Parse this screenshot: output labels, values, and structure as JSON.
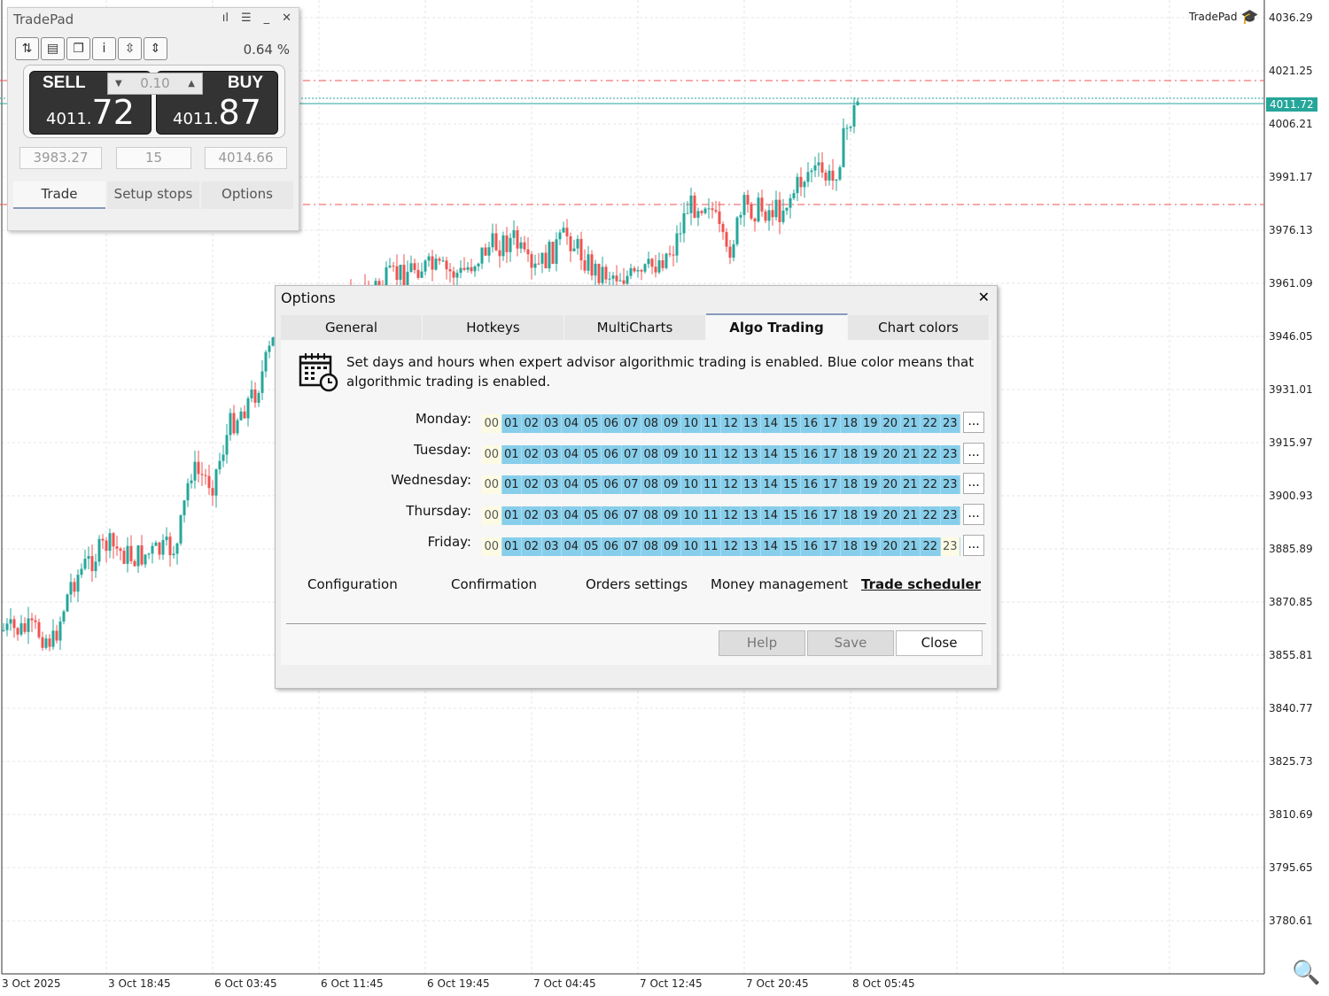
{
  "chart": {
    "price_axis": [
      "4036.29",
      "4021.25",
      "4006.21",
      "3991.17",
      "3976.13",
      "3961.09",
      "3946.05",
      "3931.01",
      "3915.97",
      "3900.93",
      "3885.89",
      "3870.85",
      "3855.81",
      "3840.77",
      "3825.73",
      "3810.69",
      "3795.65",
      "3780.61"
    ],
    "time_axis": [
      "3 Oct 2025",
      "3 Oct 18:45",
      "6 Oct 03:45",
      "6 Oct 11:45",
      "6 Oct 19:45",
      "7 Oct 04:45",
      "7 Oct 12:45",
      "7 Oct 20:45",
      "8 Oct 05:45"
    ],
    "current_price": "4011.72",
    "brand_label": "TradePad",
    "colors": {
      "bull": "#26a69a",
      "bear": "#ef5350",
      "grid": "#e6e6e6"
    }
  },
  "tradepad": {
    "title": "TradePad",
    "percent": "0.64 %",
    "sell_label": "SELL",
    "buy_label": "BUY",
    "lot": "0.10",
    "sell_price_main": "4011.",
    "sell_price_big": "72",
    "buy_price_main": "4011.",
    "buy_price_big": "87",
    "sl": "3983.27",
    "spread": "15",
    "tp": "4014.66",
    "tabs": [
      "Trade",
      "Setup stops",
      "Options"
    ]
  },
  "dialog": {
    "title": "Options",
    "tabs": [
      "General",
      "Hotkeys",
      "MultiCharts",
      "Algo Trading",
      "Chart colors"
    ],
    "description": "Set days and hours when expert advisor algorithmic trading is enabled. Blue color means that algorithmic trading is enabled.",
    "hours": [
      "00",
      "01",
      "02",
      "03",
      "04",
      "05",
      "06",
      "07",
      "08",
      "09",
      "10",
      "11",
      "12",
      "13",
      "14",
      "15",
      "16",
      "17",
      "18",
      "19",
      "20",
      "21",
      "22",
      "23"
    ],
    "days": [
      {
        "name": "Monday:",
        "disabled_hours": [
          "00"
        ]
      },
      {
        "name": "Tuesday:",
        "disabled_hours": [
          "00"
        ]
      },
      {
        "name": "Wednesday:",
        "disabled_hours": [
          "00"
        ]
      },
      {
        "name": "Thursday:",
        "disabled_hours": [
          "00"
        ]
      },
      {
        "name": "Friday:",
        "disabled_hours": [
          "00",
          "23"
        ]
      }
    ],
    "more_label": "...",
    "links": [
      "Configuration",
      "Confirmation",
      "Orders settings",
      "Money management",
      "Trade scheduler"
    ],
    "help": "Help",
    "save": "Save",
    "close": "Close"
  }
}
